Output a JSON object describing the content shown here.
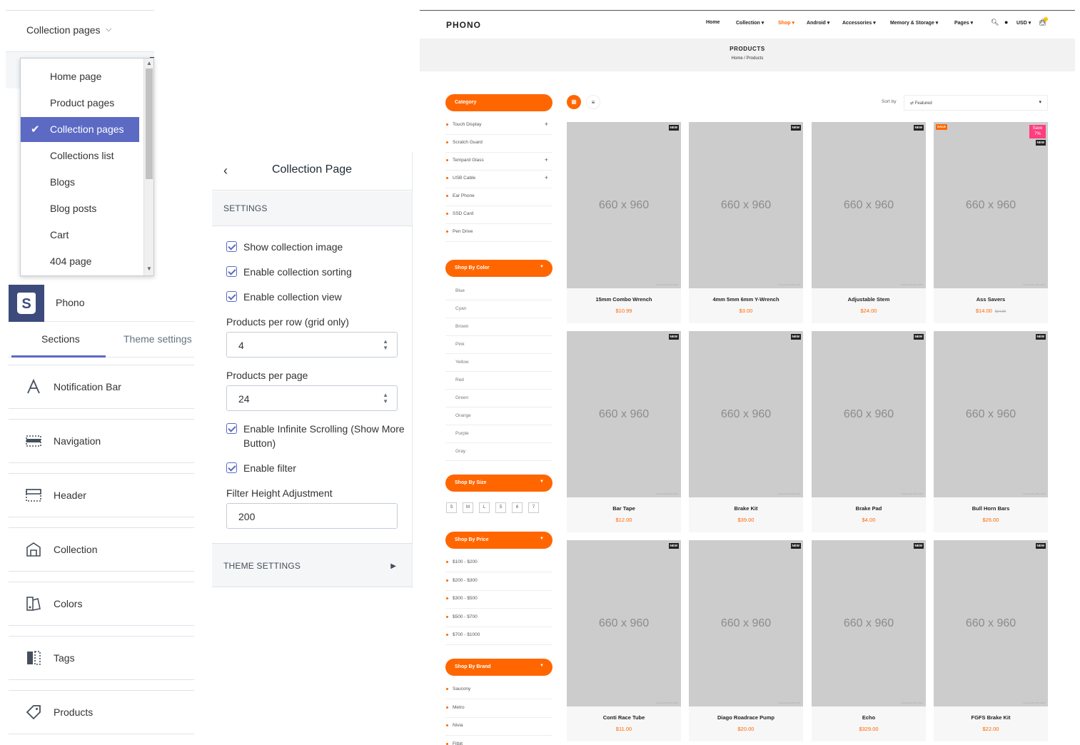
{
  "dropdown": {
    "selected_label": "Collection pages",
    "items": [
      {
        "label": "Home page"
      },
      {
        "label": "Product pages"
      },
      {
        "label": "Collection pages",
        "selected": true
      },
      {
        "label": "Collections list"
      },
      {
        "label": "Blogs"
      },
      {
        "label": "Blog posts"
      },
      {
        "label": "Cart"
      },
      {
        "label": "404 page"
      }
    ]
  },
  "sections_panel": {
    "store_name": "Phono",
    "tabs": [
      "Sections",
      "Theme settings"
    ],
    "active_tab": "Sections",
    "items": [
      {
        "label": "Notification Bar",
        "icon": "typography-icon"
      },
      {
        "label": "Navigation",
        "icon": "navigation-icon"
      },
      {
        "label": "Header",
        "icon": "header-icon"
      },
      {
        "label": "Collection",
        "icon": "collection-icon"
      },
      {
        "label": "Colors",
        "icon": "colors-icon"
      },
      {
        "label": "Tags",
        "icon": "tags-icon"
      },
      {
        "label": "Products",
        "icon": "products-icon"
      }
    ]
  },
  "settings_panel": {
    "title": "Collection Page",
    "settings_caption": "SETTINGS",
    "checkboxes": [
      {
        "label": "Show collection image",
        "checked": true
      },
      {
        "label": "Enable collection sorting",
        "checked": true
      },
      {
        "label": "Enable collection view",
        "checked": true
      }
    ],
    "per_row_label": "Products per row (grid only)",
    "per_row_value": "4",
    "per_page_label": "Products per page",
    "per_page_value": "24",
    "infinite_label": "Enable Infinite Scrolling (Show More Button)",
    "filter_label": "Enable filter",
    "filter_height_label": "Filter Height Adjustment",
    "filter_height_value": "200",
    "theme_settings_caption": "THEME SETTINGS"
  },
  "storefront": {
    "brand": "PHONO",
    "nav": [
      "Home",
      "Collection ▾",
      "Shop ▾",
      "Android ▾",
      "Accessories ▾",
      "Memory & Storage ▾",
      "Pages ▾"
    ],
    "active_nav": "Shop ▾",
    "currency": "USD ▾",
    "page_title": "PRODUCTS",
    "breadcrumb": "Home  /  Products",
    "category_heading": "Category",
    "categories": [
      {
        "label": "Touch Display",
        "expandable": true
      },
      {
        "label": "Scratch Guard",
        "expandable": false
      },
      {
        "label": "Tempard Glass",
        "expandable": true
      },
      {
        "label": "USB Cable",
        "expandable": true
      },
      {
        "label": "Ear Phone",
        "expandable": false
      },
      {
        "label": "SSD Card",
        "expandable": false
      },
      {
        "label": "Pen Drive",
        "expandable": false
      }
    ],
    "color_heading": "Shop By Color",
    "colors": [
      "Blue",
      "Cyan",
      "Brown",
      "Pink",
      "Yellow",
      "Red",
      "Green",
      "Orange",
      "Purple",
      "Gray"
    ],
    "size_heading": "Shop By Size",
    "sizes": [
      "S",
      "M",
      "L",
      "5",
      "6",
      "7"
    ],
    "price_heading": "Shop By Price",
    "prices": [
      "$100 - $200",
      "$200 - $300",
      "$300 - $500",
      "$500 - $700",
      "$700 - $1000"
    ],
    "brand_heading": "Shop By Brand",
    "brands": [
      "Saucony",
      "Metro",
      "Nivia",
      "Fitbit"
    ],
    "sort_label": "Sort by",
    "sort_value": "⇄ Featured",
    "placeholder_text": "660 x 960",
    "watermark": "Powered By IPIX.COM",
    "products": [
      {
        "name": "15mm Combo Wrench",
        "price": "$10.99",
        "badge": "NEW"
      },
      {
        "name": "4mm 5mm 6mm Y-Wrench",
        "price": "$3.00",
        "badge": "NEW"
      },
      {
        "name": "Adjustable Stem",
        "price": "$24.00",
        "badge": "NEW"
      },
      {
        "name": "Ass Savers",
        "price": "$14.00",
        "old_price": "$14.99",
        "badge": "NEW",
        "sale": "SALE",
        "save": "Save 7%"
      },
      {
        "name": "Bar Tape",
        "price": "$12.00",
        "badge": "NEW"
      },
      {
        "name": "Brake Kit",
        "price": "$39.00",
        "badge": "NEW"
      },
      {
        "name": "Brake Pad",
        "price": "$4.00",
        "badge": "NEW"
      },
      {
        "name": "Bull Horn Bars",
        "price": "$26.00",
        "badge": "NEW"
      },
      {
        "name": "Conti Race Tube",
        "price": "$11.00",
        "badge": "NEW"
      },
      {
        "name": "Diago Roadrace Pump",
        "price": "$20.00",
        "badge": "NEW"
      },
      {
        "name": "Echo",
        "price": "$329.00",
        "badge": "NEW"
      },
      {
        "name": "FGFS Brake Kit",
        "price": "$22.00",
        "badge": "NEW"
      }
    ]
  },
  "colors": {
    "accent_purple": "#5c6ac4",
    "accent_orange": "#ff6600",
    "sale_pink": "#ff3d7f"
  }
}
